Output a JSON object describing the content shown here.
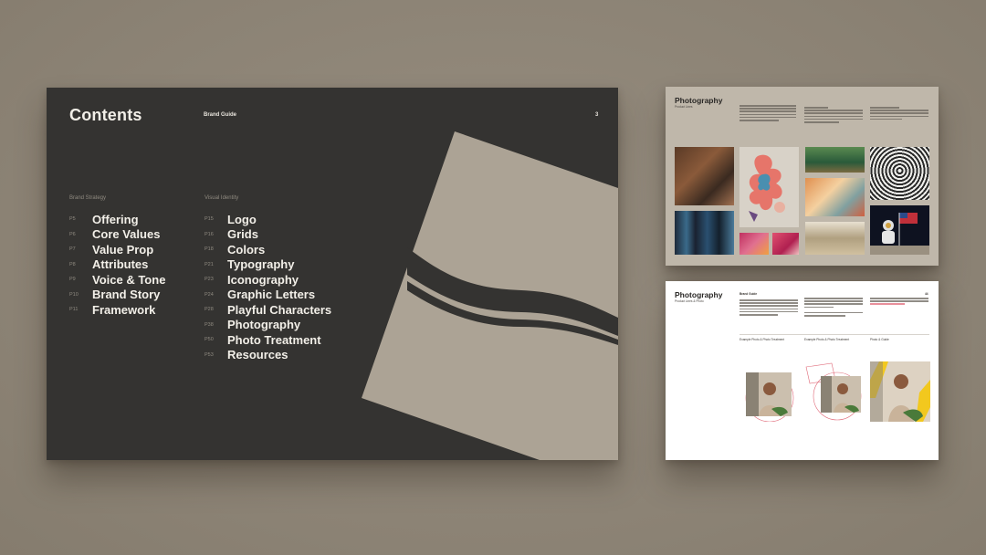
{
  "main_slide": {
    "title": "Contents",
    "brand": "Brand Guide",
    "page_number": "3",
    "sections": [
      {
        "heading": "Brand Strategy",
        "items": [
          {
            "page": "P5",
            "label": "Offering"
          },
          {
            "page": "P6",
            "label": "Core Values"
          },
          {
            "page": "P7",
            "label": "Value Prop"
          },
          {
            "page": "P8",
            "label": "Attributes"
          },
          {
            "page": "P9",
            "label": "Voice & Tone"
          },
          {
            "page": "P10",
            "label": "Brand Story"
          },
          {
            "page": "P11",
            "label": "Framework"
          }
        ]
      },
      {
        "heading": "Visual Identity",
        "items": [
          {
            "page": "P15",
            "label": "Logo"
          },
          {
            "page": "P16",
            "label": "Grids"
          },
          {
            "page": "P18",
            "label": "Colors"
          },
          {
            "page": "P21",
            "label": "Typography"
          },
          {
            "page": "P23",
            "label": "Iconography"
          },
          {
            "page": "P24",
            "label": "Graphic Letters"
          },
          {
            "page": "P28",
            "label": "Playful Characters"
          },
          {
            "page": "P38",
            "label": "Photography"
          },
          {
            "page": "P50",
            "label": "Photo Treatment"
          },
          {
            "page": "P53",
            "label": "Resources"
          }
        ]
      }
    ]
  },
  "slide_photography_grid": {
    "title": "Photography",
    "subtitle": "Product Lines"
  },
  "slide_photography_treatment": {
    "title": "Photography",
    "subtitle": "Product Lines & Photo",
    "column_head": "Brand Guide",
    "page_number": "44",
    "captions": [
      "Example Photo & Photo Treatment",
      "Example Photo & Photo Treatment",
      "Photo & Guide"
    ]
  },
  "colors": {
    "background": "#8f8678",
    "dark_slide": "#343331",
    "taupe": "#aca395",
    "accent_yellow": "#f2c81e",
    "accent_pink": "#e06b7a"
  }
}
